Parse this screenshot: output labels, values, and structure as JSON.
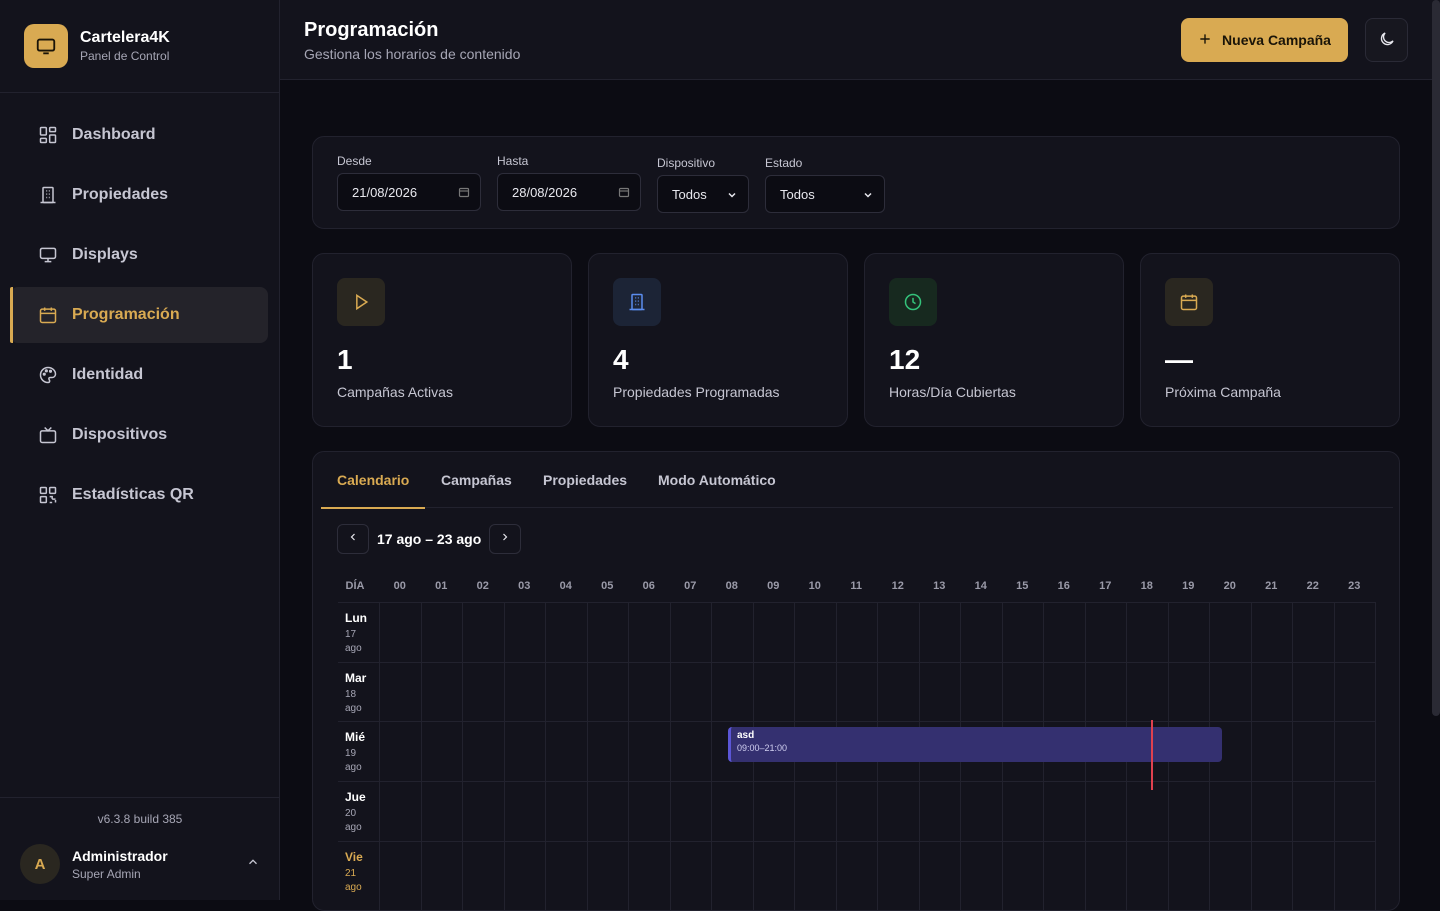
{
  "brand": {
    "title": "Cartelera4K",
    "subtitle": "Panel de Control"
  },
  "nav": [
    {
      "label": "Dashboard",
      "icon": "grid-icon",
      "active": false
    },
    {
      "label": "Propiedades",
      "icon": "building-icon",
      "active": false
    },
    {
      "label": "Displays",
      "icon": "monitor-icon",
      "active": false
    },
    {
      "label": "Programación",
      "icon": "calendar-icon",
      "active": true
    },
    {
      "label": "Identidad",
      "icon": "palette-icon",
      "active": false
    },
    {
      "label": "Dispositivos",
      "icon": "tv-icon",
      "active": false
    },
    {
      "label": "Estadísticas QR",
      "icon": "qr-icon",
      "active": false
    }
  ],
  "footer": {
    "version": "v6.3.8 build 385"
  },
  "user": {
    "initial": "A",
    "name": "Administrador",
    "role": "Super Admin"
  },
  "header": {
    "title": "Programación",
    "subtitle": "Gestiona los horarios de contenido",
    "new_button": "Nueva Campaña"
  },
  "filters": {
    "from_label": "Desde",
    "from_value": "21/08/2026",
    "to_label": "Hasta",
    "to_value": "28/08/2026",
    "device_label": "Dispositivo",
    "device_value": "Todos",
    "status_label": "Estado",
    "status_value": "Todos"
  },
  "stats": [
    {
      "value": "1",
      "label": "Campañas Activas",
      "icon": "play-icon",
      "color": "#d9aa52",
      "bg": "#2a2720"
    },
    {
      "value": "4",
      "label": "Propiedades Programadas",
      "icon": "building-icon",
      "color": "#5b8def",
      "bg": "#1c2436"
    },
    {
      "value": "12",
      "label": "Horas/Día Cubiertas",
      "icon": "clock-icon",
      "color": "#34c27a",
      "bg": "#17291f"
    },
    {
      "value": "—",
      "label": "Próxima Campaña",
      "icon": "calendar-icon",
      "color": "#d9aa52",
      "bg": "#2a2720"
    }
  ],
  "tabs": [
    "Calendario",
    "Campañas",
    "Propiedades",
    "Modo Automático"
  ],
  "week": {
    "label": "17 ago – 23 ago"
  },
  "calendar": {
    "day_header": "DÍA",
    "hours": [
      "00",
      "01",
      "02",
      "03",
      "04",
      "05",
      "06",
      "07",
      "08",
      "09",
      "10",
      "11",
      "12",
      "13",
      "14",
      "15",
      "16",
      "17",
      "18",
      "19",
      "20",
      "21",
      "22",
      "23"
    ],
    "days": [
      {
        "name": "Lun",
        "date": "17 ago",
        "today": false
      },
      {
        "name": "Mar",
        "date": "18 ago",
        "today": false
      },
      {
        "name": "Mié",
        "date": "19 ago",
        "today": false
      },
      {
        "name": "Jue",
        "date": "20 ago",
        "today": false
      },
      {
        "name": "Vie",
        "date": "21 ago",
        "today": true
      }
    ],
    "campaign": {
      "name": "asd",
      "time": "09:00–21:00",
      "color": "#5b56d6"
    }
  }
}
